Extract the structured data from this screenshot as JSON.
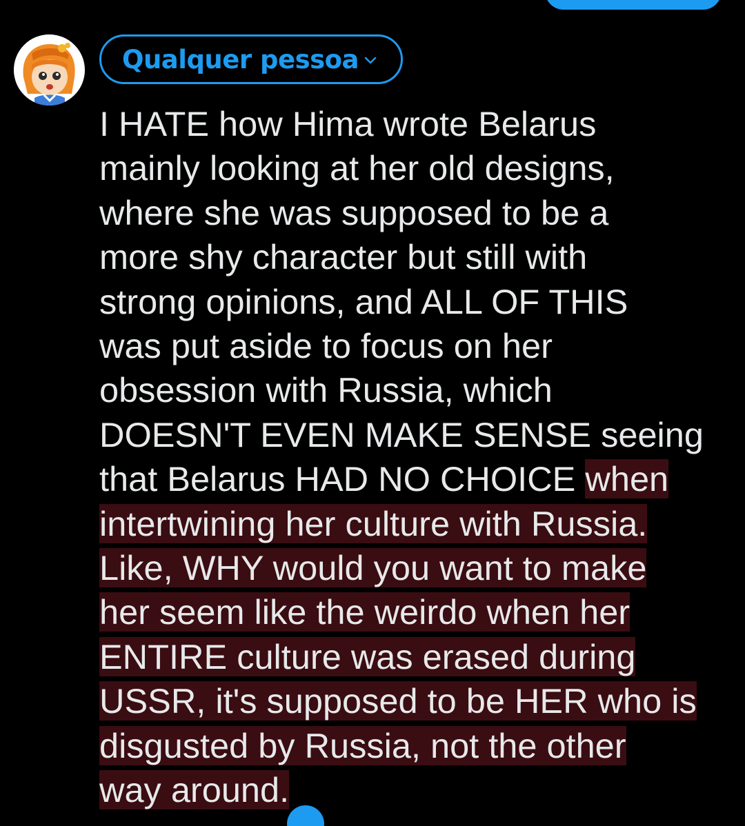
{
  "composer": {
    "audience_label": "Qualquer pessoa",
    "text_within_limit": "I HATE how Hima wrote Belarus\nmainly looking at her old designs,\nwhere she was supposed to be a\nmore shy character but still with\nstrong opinions, and ALL OF THIS\nwas put aside to focus on her\nobsession with Russia, which\nDOESN'T EVEN MAKE SENSE seeing\nthat Belarus HAD NO CHOICE ",
    "text_over_limit": "when\nintertwining her culture with Russia.\nLike, WHY would you want to make\nher seem like the weirdo when her\nENTIRE culture was erased during\nUSSR, it's supposed to be HER who is\ndisgusted by Russia, not the other\nway around."
  },
  "icons": {
    "avatar": "avatar-illustration",
    "audience_chevron": "chevron-down-icon",
    "selection_handle": "text-cursor-handle"
  },
  "colors": {
    "accent": "#1d9bf0",
    "text": "#e7e9ea",
    "over_limit_highlight": "#3a0d12",
    "background": "#000000"
  }
}
